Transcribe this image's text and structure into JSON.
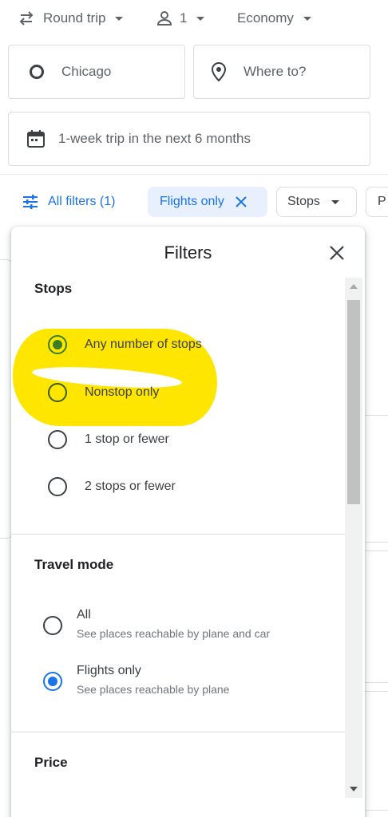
{
  "search_bar": {
    "trip_type": "Round trip",
    "passengers": "1",
    "cabin_class": "Economy",
    "origin": "Chicago",
    "destination_placeholder": "Where to?",
    "dates": "1-week trip in the next 6 months"
  },
  "chips": {
    "all_filters": "All filters (1)",
    "flights_only": "Flights only",
    "stops": "Stops",
    "partial": "P"
  },
  "filters_dialog": {
    "title": "Filters",
    "stops": {
      "title": "Stops",
      "options": [
        {
          "label": "Any number of stops",
          "selected": true
        },
        {
          "label": "Nonstop only",
          "selected": false
        },
        {
          "label": "1 stop or fewer",
          "selected": false
        },
        {
          "label": "2 stops or fewer",
          "selected": false
        }
      ]
    },
    "travel_mode": {
      "title": "Travel mode",
      "options": [
        {
          "label": "All",
          "description": "See places reachable by plane and car",
          "selected": false
        },
        {
          "label": "Flights only",
          "description": "See places reachable by plane",
          "selected": true
        }
      ]
    },
    "price": {
      "title": "Price"
    }
  },
  "colors": {
    "accent_blue": "#1a73e8",
    "chip_selected_bg": "#e8f0fe",
    "radio_green": "#3a7d22",
    "highlight_yellow": "#ffe600",
    "text_primary": "#202124",
    "text_secondary": "#5f6368"
  },
  "icons": {
    "trip_type": "swap-arrows-icon",
    "passengers": "person-icon",
    "origin": "circle-origin-icon",
    "destination": "location-pin-icon",
    "dates": "calendar-icon",
    "filters": "tune-sliders-icon",
    "chip_remove": "close-x-icon",
    "dialog_close": "close-icon"
  }
}
